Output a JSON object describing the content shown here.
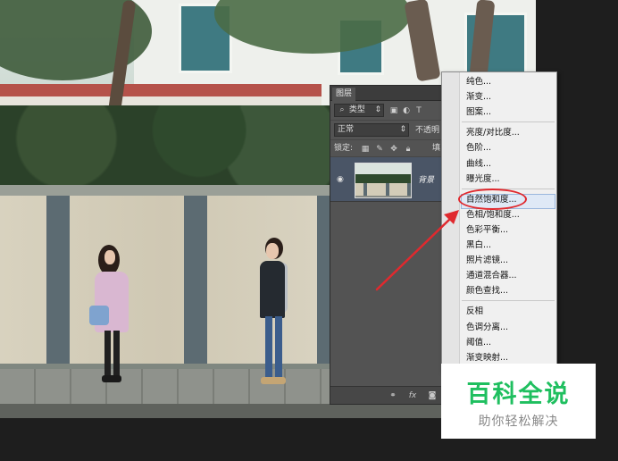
{
  "layers_panel": {
    "tab_title": "图层",
    "filter_label": "类型",
    "blend_mode": "正常",
    "opacity_label": "不透明",
    "lock_label": "锁定:",
    "fill_label": "填",
    "layer_name": "背景"
  },
  "adjustment_menu": {
    "selected_index": 7,
    "groups": [
      [
        "纯色...",
        "渐变...",
        "图案..."
      ],
      [
        "亮度/对比度...",
        "色阶...",
        "曲线...",
        "曝光度..."
      ],
      [
        "自然饱和度...",
        "色相/饱和度...",
        "色彩平衡...",
        "黑白...",
        "照片滤镜...",
        "通道混合器...",
        "颜色查找..."
      ],
      [
        "反相",
        "色调分离...",
        "阈值...",
        "渐变映射..."
      ]
    ]
  },
  "colors": {
    "annotation_red": "#e0292e",
    "watermark_green": "#1fbf5f"
  },
  "watermark": {
    "title": "百科全说",
    "subtitle": "助你轻松解决"
  }
}
